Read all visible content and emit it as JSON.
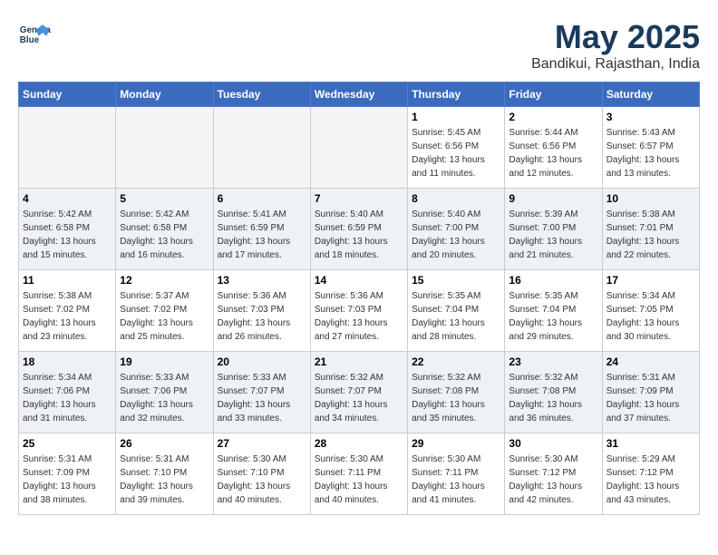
{
  "header": {
    "logo_line1": "General",
    "logo_line2": "Blue",
    "month": "May 2025",
    "location": "Bandikui, Rajasthan, India"
  },
  "weekdays": [
    "Sunday",
    "Monday",
    "Tuesday",
    "Wednesday",
    "Thursday",
    "Friday",
    "Saturday"
  ],
  "weeks": [
    [
      {
        "day": "",
        "info": "",
        "empty": true
      },
      {
        "day": "",
        "info": "",
        "empty": true
      },
      {
        "day": "",
        "info": "",
        "empty": true
      },
      {
        "day": "",
        "info": "",
        "empty": true
      },
      {
        "day": "1",
        "info": "Sunrise: 5:45 AM\nSunset: 6:56 PM\nDaylight: 13 hours\nand 11 minutes."
      },
      {
        "day": "2",
        "info": "Sunrise: 5:44 AM\nSunset: 6:56 PM\nDaylight: 13 hours\nand 12 minutes."
      },
      {
        "day": "3",
        "info": "Sunrise: 5:43 AM\nSunset: 6:57 PM\nDaylight: 13 hours\nand 13 minutes."
      }
    ],
    [
      {
        "day": "4",
        "info": "Sunrise: 5:42 AM\nSunset: 6:58 PM\nDaylight: 13 hours\nand 15 minutes."
      },
      {
        "day": "5",
        "info": "Sunrise: 5:42 AM\nSunset: 6:58 PM\nDaylight: 13 hours\nand 16 minutes."
      },
      {
        "day": "6",
        "info": "Sunrise: 5:41 AM\nSunset: 6:59 PM\nDaylight: 13 hours\nand 17 minutes."
      },
      {
        "day": "7",
        "info": "Sunrise: 5:40 AM\nSunset: 6:59 PM\nDaylight: 13 hours\nand 18 minutes."
      },
      {
        "day": "8",
        "info": "Sunrise: 5:40 AM\nSunset: 7:00 PM\nDaylight: 13 hours\nand 20 minutes."
      },
      {
        "day": "9",
        "info": "Sunrise: 5:39 AM\nSunset: 7:00 PM\nDaylight: 13 hours\nand 21 minutes."
      },
      {
        "day": "10",
        "info": "Sunrise: 5:38 AM\nSunset: 7:01 PM\nDaylight: 13 hours\nand 22 minutes."
      }
    ],
    [
      {
        "day": "11",
        "info": "Sunrise: 5:38 AM\nSunset: 7:02 PM\nDaylight: 13 hours\nand 23 minutes."
      },
      {
        "day": "12",
        "info": "Sunrise: 5:37 AM\nSunset: 7:02 PM\nDaylight: 13 hours\nand 25 minutes."
      },
      {
        "day": "13",
        "info": "Sunrise: 5:36 AM\nSunset: 7:03 PM\nDaylight: 13 hours\nand 26 minutes."
      },
      {
        "day": "14",
        "info": "Sunrise: 5:36 AM\nSunset: 7:03 PM\nDaylight: 13 hours\nand 27 minutes."
      },
      {
        "day": "15",
        "info": "Sunrise: 5:35 AM\nSunset: 7:04 PM\nDaylight: 13 hours\nand 28 minutes."
      },
      {
        "day": "16",
        "info": "Sunrise: 5:35 AM\nSunset: 7:04 PM\nDaylight: 13 hours\nand 29 minutes."
      },
      {
        "day": "17",
        "info": "Sunrise: 5:34 AM\nSunset: 7:05 PM\nDaylight: 13 hours\nand 30 minutes."
      }
    ],
    [
      {
        "day": "18",
        "info": "Sunrise: 5:34 AM\nSunset: 7:06 PM\nDaylight: 13 hours\nand 31 minutes."
      },
      {
        "day": "19",
        "info": "Sunrise: 5:33 AM\nSunset: 7:06 PM\nDaylight: 13 hours\nand 32 minutes."
      },
      {
        "day": "20",
        "info": "Sunrise: 5:33 AM\nSunset: 7:07 PM\nDaylight: 13 hours\nand 33 minutes."
      },
      {
        "day": "21",
        "info": "Sunrise: 5:32 AM\nSunset: 7:07 PM\nDaylight: 13 hours\nand 34 minutes."
      },
      {
        "day": "22",
        "info": "Sunrise: 5:32 AM\nSunset: 7:08 PM\nDaylight: 13 hours\nand 35 minutes."
      },
      {
        "day": "23",
        "info": "Sunrise: 5:32 AM\nSunset: 7:08 PM\nDaylight: 13 hours\nand 36 minutes."
      },
      {
        "day": "24",
        "info": "Sunrise: 5:31 AM\nSunset: 7:09 PM\nDaylight: 13 hours\nand 37 minutes."
      }
    ],
    [
      {
        "day": "25",
        "info": "Sunrise: 5:31 AM\nSunset: 7:09 PM\nDaylight: 13 hours\nand 38 minutes."
      },
      {
        "day": "26",
        "info": "Sunrise: 5:31 AM\nSunset: 7:10 PM\nDaylight: 13 hours\nand 39 minutes."
      },
      {
        "day": "27",
        "info": "Sunrise: 5:30 AM\nSunset: 7:10 PM\nDaylight: 13 hours\nand 40 minutes."
      },
      {
        "day": "28",
        "info": "Sunrise: 5:30 AM\nSunset: 7:11 PM\nDaylight: 13 hours\nand 40 minutes."
      },
      {
        "day": "29",
        "info": "Sunrise: 5:30 AM\nSunset: 7:11 PM\nDaylight: 13 hours\nand 41 minutes."
      },
      {
        "day": "30",
        "info": "Sunrise: 5:30 AM\nSunset: 7:12 PM\nDaylight: 13 hours\nand 42 minutes."
      },
      {
        "day": "31",
        "info": "Sunrise: 5:29 AM\nSunset: 7:12 PM\nDaylight: 13 hours\nand 43 minutes."
      }
    ]
  ]
}
